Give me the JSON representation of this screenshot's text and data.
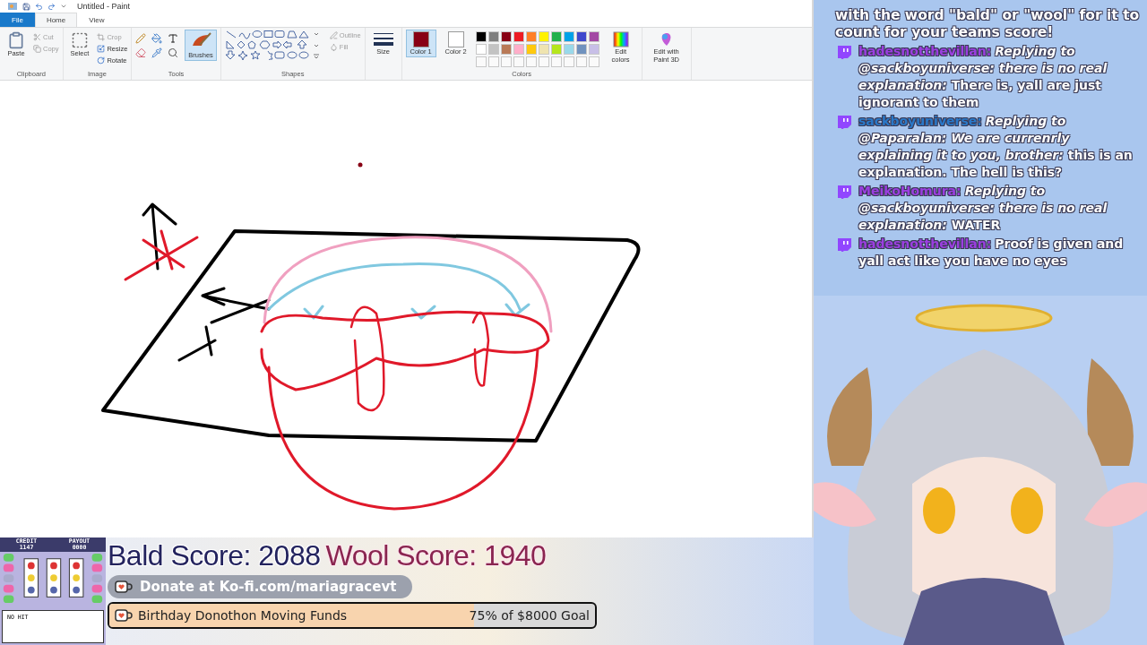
{
  "paint": {
    "title": "Untitled - Paint",
    "tabs": [
      {
        "label": "File",
        "kind": "file",
        "selected": false
      },
      {
        "label": "Home",
        "kind": "tab",
        "selected": true
      },
      {
        "label": "View",
        "kind": "tab",
        "selected": false
      }
    ],
    "ribbon": {
      "clipboard": {
        "label": "Clipboard",
        "paste": "Paste",
        "items": [
          {
            "label": "Cut",
            "disabled": true
          },
          {
            "label": "Copy",
            "disabled": true
          }
        ]
      },
      "image": {
        "label": "Image",
        "select": "Select",
        "items": [
          {
            "label": "Crop",
            "disabled": true
          },
          {
            "label": "Resize",
            "disabled": false
          },
          {
            "label": "Rotate",
            "disabled": false
          }
        ]
      },
      "tools": {
        "label": "Tools",
        "brushes": {
          "label": "Brushes",
          "selected": true
        }
      },
      "shapes": {
        "label": "Shapes",
        "items": [
          {
            "label": "Outline",
            "disabled": true
          },
          {
            "label": "Fill",
            "disabled": true
          }
        ]
      },
      "size": "Size",
      "colors": {
        "label": "Colors",
        "slots": [
          {
            "label": "Color 1",
            "color": "#880015",
            "selected": true
          },
          {
            "label": "Color 2",
            "color": "#ffffff",
            "selected": false
          }
        ],
        "palette": [
          {
            "color": "#000000"
          },
          {
            "color": "#7f7f7f"
          },
          {
            "color": "#880015"
          },
          {
            "color": "#ed1c24"
          },
          {
            "color": "#ff7f27"
          },
          {
            "color": "#fff200"
          },
          {
            "color": "#22b14c"
          },
          {
            "color": "#00a2e8"
          },
          {
            "color": "#3f48cc"
          },
          {
            "color": "#a349a4"
          },
          {
            "color": "#ffffff"
          },
          {
            "color": "#c3c3c3"
          },
          {
            "color": "#b97a57"
          },
          {
            "color": "#ffaec9"
          },
          {
            "color": "#ffc90e"
          },
          {
            "color": "#efe4b0"
          },
          {
            "color": "#b5e61d"
          },
          {
            "color": "#99d9ea"
          },
          {
            "color": "#7092be"
          },
          {
            "color": "#c8bfe7"
          }
        ],
        "edit": "Edit colors"
      },
      "paint3d": "Edit with Paint 3D"
    }
  },
  "chat": {
    "intro": "with the word \"bald\" or \"wool\" for it to count for your teams score!",
    "messages": [
      {
        "user": "hadesnotthevillan:",
        "color": "#9b3fe0",
        "text": "*Replying to @sackboyuniverse: there is no real explanation:* There is, yall are just ignorant to them"
      },
      {
        "user": "sackboyuniverse:",
        "color": "#2a78c8",
        "text": "*Replying to @Paparalan: We are currenrly explaining it to you, brother:* this is an explanation. The hell is this?"
      },
      {
        "user": "MeikoHomura:",
        "color": "#9b3fe0",
        "text": "*Replying to @sackboyuniverse: there is no real explanation:* WATER"
      },
      {
        "user": "hadesnotthevillan:",
        "color": "#9b3fe0",
        "text": "Proof is given and yall act like you have no eyes"
      }
    ]
  },
  "slot_game": {
    "credit_label": "CREDIT",
    "credit": "1147",
    "payout_label": "PAYOUT",
    "payout": "0000",
    "status": "NO HIT"
  },
  "scores": [
    {
      "label": "Bald Score: 2088",
      "kind": "bald"
    },
    {
      "label": "Wool Score: 1940",
      "kind": "wool"
    }
  ],
  "donate": "Donate at Ko-fi.com/mariagracevt",
  "goal": {
    "label": "Birthday Donothon Moving Funds",
    "level": 0.75,
    "reading": "75% of $8000 Goal"
  }
}
